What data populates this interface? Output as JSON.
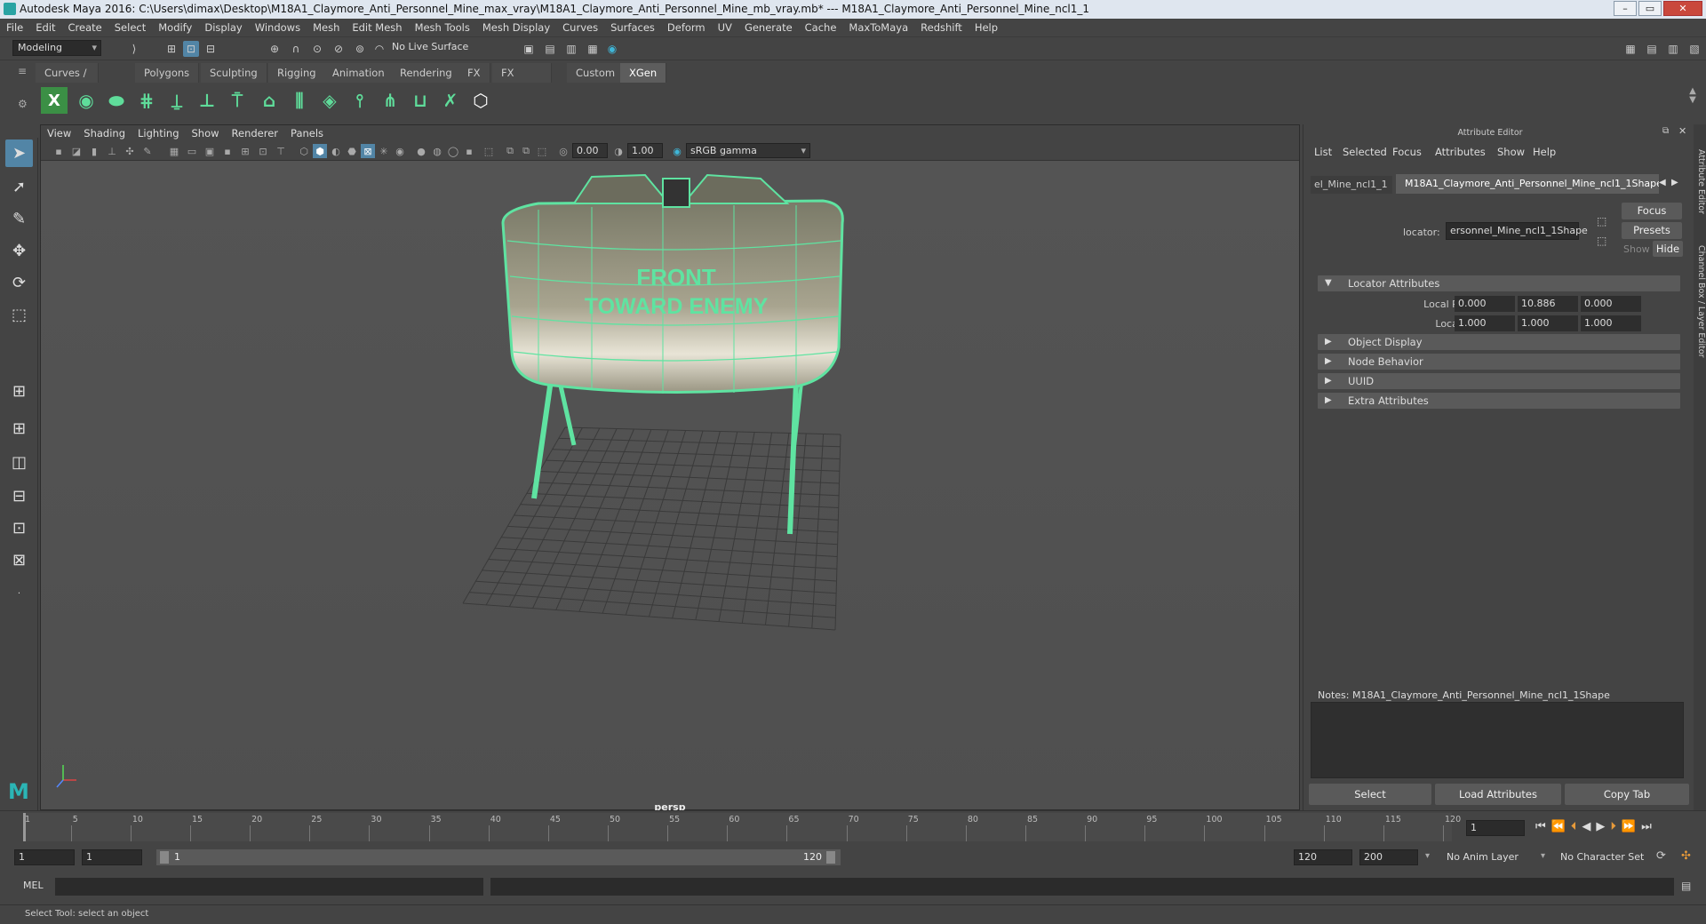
{
  "window": {
    "title": "Autodesk Maya 2016: C:\\Users\\dimax\\Desktop\\M18A1_Claymore_Anti_Personnel_Mine_max_vray\\M18A1_Claymore_Anti_Personnel_Mine_mb_vray.mb*   ---   M18A1_Claymore_Anti_Personnel_Mine_ncl1_1",
    "minimize": "–",
    "maximize": "▭",
    "close": "✕"
  },
  "menubar": [
    "File",
    "Edit",
    "Create",
    "Select",
    "Modify",
    "Display",
    "Windows",
    "Mesh",
    "Edit Mesh",
    "Mesh Tools",
    "Mesh Display",
    "Curves",
    "Surfaces",
    "Deform",
    "UV",
    "Generate",
    "Cache",
    "MaxToMaya",
    "Redshift",
    "Help"
  ],
  "statusline": {
    "mode": "Modeling",
    "live_surface": "No Live Surface"
  },
  "shelf_tabs": [
    "Curves / Surfaces",
    "Polygons",
    "Sculpting",
    "Rigging",
    "Animation",
    "Rendering",
    "FX",
    "FX Caching",
    "Custom",
    "XGen"
  ],
  "shelf_active": "XGen",
  "shelf_icons": [
    "xgen-logo-icon",
    "eye-icon",
    "leaf-icon",
    "grid-grow-icon",
    "comb-icon",
    "place-guide-icon",
    "add-guide-icon",
    "lock-icon",
    "sculpt-icon",
    "layers-icon",
    "brush-icon",
    "fork-icon",
    "cut-icon",
    "tools-icon",
    "hex-icon"
  ],
  "viewport": {
    "menu": [
      "View",
      "Shading",
      "Lighting",
      "Show",
      "Renderer",
      "Panels"
    ],
    "exposure": "0.00",
    "gamma": "1.00",
    "colorspace": "sRGB gamma",
    "camera_label": "persp",
    "model_text_line1": "FRONT",
    "model_text_line2": "TOWARD ENEMY",
    "accent": "#5fe3a1"
  },
  "attribute_editor": {
    "title": "Attribute Editor",
    "menu": [
      "List",
      "Selected",
      "Focus",
      "Attributes",
      "Show",
      "Help"
    ],
    "tab_left": "el_Mine_ncl1_1",
    "tab_active": "M18A1_Claymore_Anti_Personnel_Mine_ncl1_1Shape",
    "locator_label": "locator:",
    "locator_value": "ersonnel_Mine_ncl1_1Shape",
    "focus_button": "Focus",
    "presets_button": "Presets",
    "show_button": "Show",
    "hide_button": "Hide",
    "sections": {
      "locator_attributes": "Locator Attributes",
      "object_display": "Object Display",
      "node_behavior": "Node Behavior",
      "uuid": "UUID",
      "extra_attributes": "Extra Attributes"
    },
    "local_position_label": "Local Position",
    "local_position": [
      "0.000",
      "10.886",
      "0.000"
    ],
    "local_scale_label": "Local Scale",
    "local_scale": [
      "1.000",
      "1.000",
      "1.000"
    ],
    "notes_label": "Notes:  M18A1_Claymore_Anti_Personnel_Mine_ncl1_1Shape",
    "select_button": "Select",
    "load_button": "Load Attributes",
    "copy_button": "Copy Tab"
  },
  "right_tabs": [
    "Attribute Editor",
    "Channel Box / Layer Editor"
  ],
  "timeline": {
    "ticks": [
      "1",
      "5",
      "10",
      "15",
      "20",
      "25",
      "30",
      "35",
      "40",
      "45",
      "50",
      "55",
      "60",
      "65",
      "70",
      "75",
      "80",
      "85",
      "90",
      "95",
      "100",
      "105",
      "110",
      "115",
      "120"
    ],
    "current_frame": "1"
  },
  "range": {
    "start": "1",
    "playback_start": "1",
    "slider_start": "1",
    "slider_end": "120",
    "playback_end": "120",
    "end": "200",
    "anim_layer": "No Anim Layer",
    "character_set": "No Character Set"
  },
  "command": {
    "language": "MEL"
  },
  "help_line": "Select Tool: select an object"
}
